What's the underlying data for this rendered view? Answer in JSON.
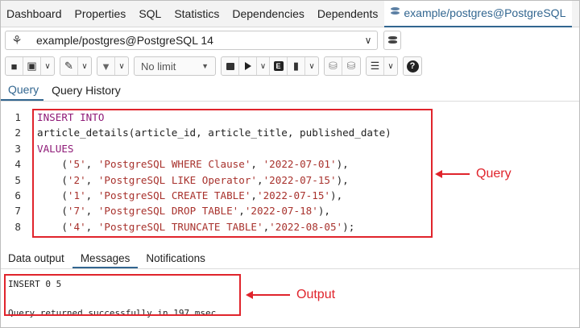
{
  "top_tabs": [
    "Dashboard",
    "Properties",
    "SQL",
    "Statistics",
    "Dependencies",
    "Dependents"
  ],
  "active_tab": "example/postgres@PostgreSQL",
  "connection": {
    "value": "example/postgres@PostgreSQL 14"
  },
  "toolbar": {
    "limit_label": "No limit"
  },
  "query_tabs": [
    "Query",
    "Query History"
  ],
  "editor": {
    "line_numbers": [
      "1",
      "2",
      "3",
      "4",
      "5",
      "6",
      "7",
      "8"
    ],
    "lines": [
      [
        {
          "t": "INSERT INTO",
          "c": "kw"
        }
      ],
      [
        {
          "t": "article_details(article_id, article_title, published_date)",
          "c": "pl"
        }
      ],
      [
        {
          "t": "VALUES",
          "c": "kw"
        }
      ],
      [
        {
          "t": "    (",
          "c": "pl"
        },
        {
          "t": "'5'",
          "c": "str"
        },
        {
          "t": ", ",
          "c": "pl"
        },
        {
          "t": "'PostgreSQL WHERE Clause'",
          "c": "str"
        },
        {
          "t": ", ",
          "c": "pl"
        },
        {
          "t": "'2022-07-01'",
          "c": "str"
        },
        {
          "t": "),",
          "c": "pl"
        }
      ],
      [
        {
          "t": "    (",
          "c": "pl"
        },
        {
          "t": "'2'",
          "c": "str"
        },
        {
          "t": ", ",
          "c": "pl"
        },
        {
          "t": "'PostgreSQL LIKE Operator'",
          "c": "str"
        },
        {
          "t": ",",
          "c": "pl"
        },
        {
          "t": "'2022-07-15'",
          "c": "str"
        },
        {
          "t": "),",
          "c": "pl"
        }
      ],
      [
        {
          "t": "    (",
          "c": "pl"
        },
        {
          "t": "'1'",
          "c": "str"
        },
        {
          "t": ", ",
          "c": "pl"
        },
        {
          "t": "'PostgreSQL CREATE TABLE'",
          "c": "str"
        },
        {
          "t": ",",
          "c": "pl"
        },
        {
          "t": "'2022-07-15'",
          "c": "str"
        },
        {
          "t": "),",
          "c": "pl"
        }
      ],
      [
        {
          "t": "    (",
          "c": "pl"
        },
        {
          "t": "'7'",
          "c": "str"
        },
        {
          "t": ", ",
          "c": "pl"
        },
        {
          "t": "'PostgreSQL DROP TABLE'",
          "c": "str"
        },
        {
          "t": ",",
          "c": "pl"
        },
        {
          "t": "'2022-07-18'",
          "c": "str"
        },
        {
          "t": "),",
          "c": "pl"
        }
      ],
      [
        {
          "t": "    (",
          "c": "pl"
        },
        {
          "t": "'4'",
          "c": "str"
        },
        {
          "t": ", ",
          "c": "pl"
        },
        {
          "t": "'PostgreSQL TRUNCATE TABLE'",
          "c": "str"
        },
        {
          "t": ",",
          "c": "pl"
        },
        {
          "t": "'2022-08-05'",
          "c": "str"
        },
        {
          "t": ");",
          "c": "pl"
        }
      ]
    ]
  },
  "result_tabs": [
    "Data output",
    "Messages",
    "Notifications"
  ],
  "messages": [
    "INSERT 0 5",
    "",
    "Query returned successfully in 197 msec."
  ],
  "annotations": {
    "query": "Query",
    "output": "Output"
  },
  "colors": {
    "accent": "#326690",
    "highlight": "#e0242c",
    "keyword": "#8f1b78",
    "string": "#a8322d"
  }
}
